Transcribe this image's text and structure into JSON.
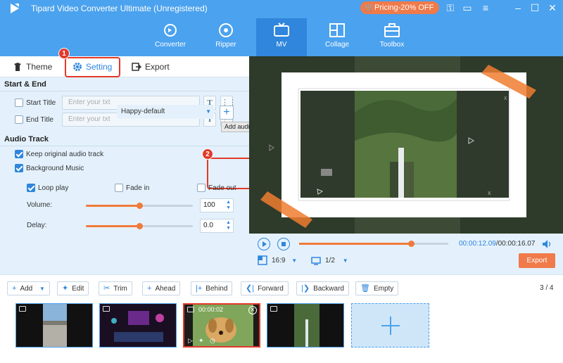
{
  "app": {
    "title": "Tipard Video Converter Ultimate (Unregistered)",
    "pricing_label": "Pricing-20% OFF"
  },
  "nav": [
    {
      "label": "Converter",
      "icon": "refresh-icon"
    },
    {
      "label": "Ripper",
      "icon": "disc-icon"
    },
    {
      "label": "MV",
      "icon": "tv-icon",
      "active": true
    },
    {
      "label": "Collage",
      "icon": "grid-icon"
    },
    {
      "label": "Toolbox",
      "icon": "toolbox-icon"
    }
  ],
  "tabs": {
    "theme": "Theme",
    "setting": "Setting",
    "export": "Export",
    "active": "Setting"
  },
  "callouts": {
    "one": "1",
    "two": "2"
  },
  "start_end": {
    "heading": "Start & End",
    "start_title_label": "Start Title",
    "start_title_placeholder": "Enter your txt",
    "end_title_label": "End Title",
    "end_title_placeholder": "Enter your txt",
    "start_checked": false,
    "end_checked": false
  },
  "audio": {
    "heading": "Audio Track",
    "keep_original_label": "Keep original audio track",
    "keep_original_checked": true,
    "background_music_label": "Background Music",
    "background_music_checked": true,
    "music_value": "Happy-default",
    "add_audio_tooltip": "Add audio",
    "loop_play_label": "Loop play",
    "loop_play_checked": true,
    "fade_in_label": "Fade in",
    "fade_in_checked": false,
    "fade_out_label": "Fade out",
    "fade_out_checked": false,
    "volume_label": "Volume:",
    "volume_value": "100",
    "volume_level": 0.5,
    "delay_label": "Delay:",
    "delay_value": "0.0",
    "delay_level": 0.5
  },
  "player": {
    "current_time": "00:00:12.09",
    "total_time": "/00:00:16.07",
    "progress": 0.75,
    "aspect": "16:9",
    "screen": "1/2",
    "export_label": "Export"
  },
  "toolbar": {
    "add": "Add",
    "edit": "Edit",
    "trim": "Trim",
    "ahead": "Ahead",
    "behind": "Behind",
    "forward": "Forward",
    "backward": "Backward",
    "empty": "Empty",
    "page": "3 / 4"
  },
  "clips": [
    {
      "type": "video"
    },
    {
      "type": "image"
    },
    {
      "type": "image",
      "duration": "00:00:02",
      "selected": true
    },
    {
      "type": "image"
    }
  ]
}
